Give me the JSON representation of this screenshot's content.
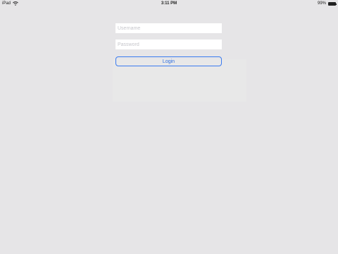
{
  "status_bar": {
    "device": "iPad",
    "wifi_icon": "wifi-icon",
    "time": "3:11 PM",
    "battery_percent": "99%",
    "battery_level": 0.99
  },
  "login": {
    "username_placeholder": "Username",
    "username_value": "",
    "password_placeholder": "Password",
    "password_value": "",
    "button_label": "Login"
  },
  "colors": {
    "background": "#e6e5e7",
    "accent": "#2f6fe0",
    "field_background": "#ffffff"
  }
}
